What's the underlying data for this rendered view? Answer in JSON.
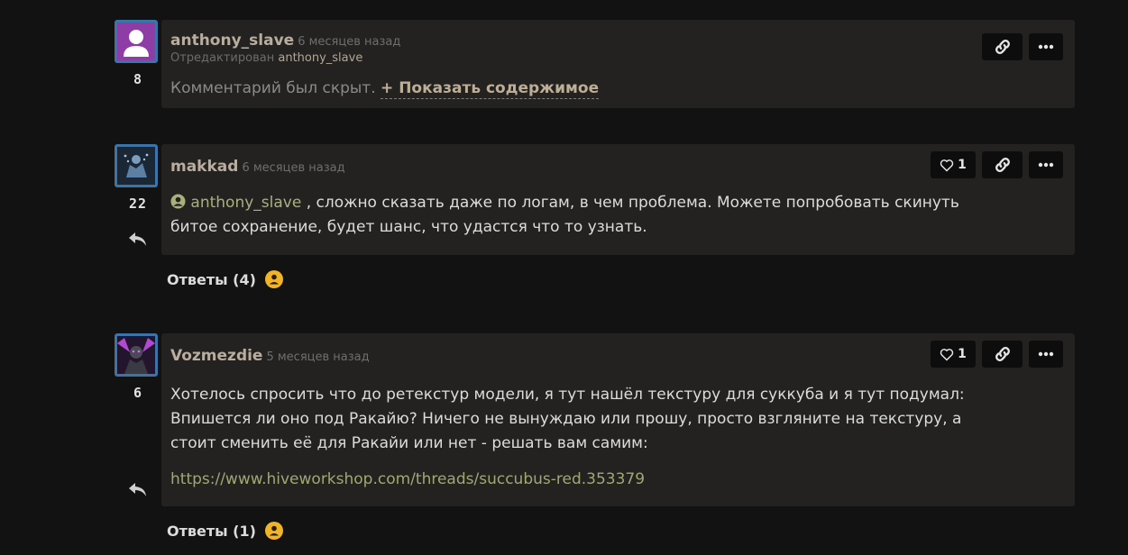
{
  "comments": [
    {
      "author": "anthony_slave",
      "time": "6 месяцев назад",
      "edited_label": "Отредактирован",
      "edited_by": "anthony_slave",
      "rank": "8",
      "hidden_text": "Комментарий был скрыт.",
      "show_link": "+ Показать содержимое"
    },
    {
      "author": "makkad",
      "time": "6 месяцев назад",
      "rank": "22",
      "likes": "1",
      "mention": "anthony_slave",
      "body_line1": ", сложно сказать даже по логам, в чем проблема. Можете попробовать скинуть",
      "body_line2": "битое сохранение, будет шанс, что удастся что то узнать.",
      "answers": "Ответы (4)"
    },
    {
      "author": "Vozmezdie",
      "time": "5 месяцев назад",
      "rank": "6",
      "likes": "1",
      "body_line1": "Хотелось спросить что до ретекстур модели, я тут нашёл текстуру для суккуба и я тут подумал:",
      "body_line2": "Впишется ли оно под Ракайю? Ничего не вынуждаю или прошу, просто взгляните на текстуру, а",
      "body_line3": "стоит сменить её для Ракайи или нет - решать вам самим:",
      "link": "https://www.hiveworkshop.com/threads/succubus-red.353379",
      "answers": "Ответы (1)"
    }
  ],
  "icons": {
    "heart": "heart-icon",
    "link": "link-icon",
    "more": "more-icon",
    "reply": "reply-icon",
    "user": "user-icon",
    "emoji": "emoji-icon"
  },
  "colors": {
    "background": "#121212",
    "card": "#242220",
    "avatar_border": "#3b74a8",
    "author": "#b8ad9e",
    "link": "#a2a773",
    "emoji": "#f0b429"
  }
}
